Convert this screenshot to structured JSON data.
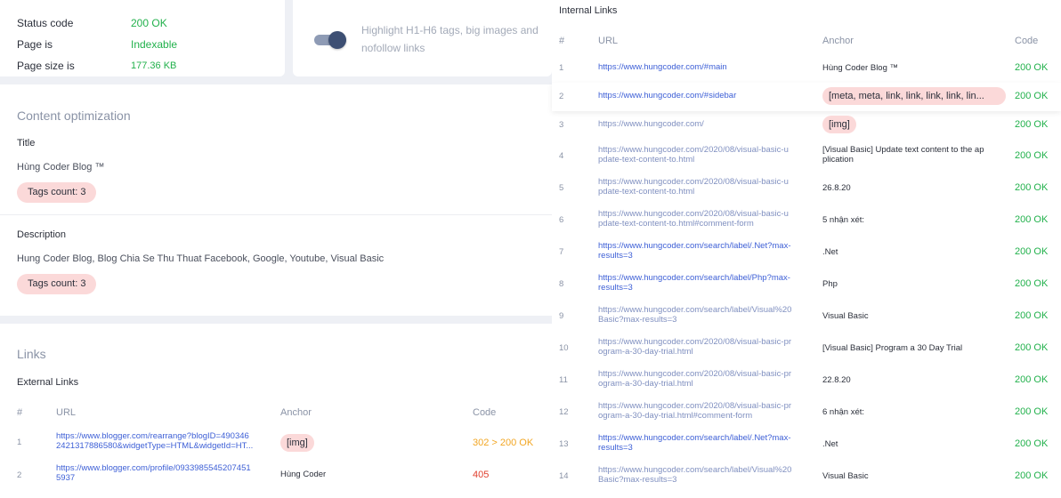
{
  "status": {
    "rows": [
      {
        "label": "Status code",
        "value": "200 OK"
      },
      {
        "label": "Page is",
        "value": "Indexable"
      },
      {
        "label": "Page size is",
        "value": "177.36 KB"
      }
    ]
  },
  "toggle": {
    "label": "Highlight H1-H6 tags, big images and nofollow links",
    "on": true
  },
  "content": {
    "title": "Content optimization",
    "title_section": {
      "heading": "Title",
      "value": "Hùng Coder Blog ™",
      "tags": "Tags count: 3"
    },
    "description_section": {
      "heading": "Description",
      "value": "Hung Coder Blog, Blog Chia Se Thu Thuat Facebook, Google, Youtube, Visual Basic",
      "tags": "Tags count: 3"
    }
  },
  "links": {
    "title": "Links",
    "external": {
      "heading": "External Links",
      "columns": [
        "#",
        "URL",
        "Anchor",
        "Code"
      ],
      "rows": [
        {
          "n": "1",
          "url1": "https://www.blogger.com/rearrange?blogID=490346",
          "url2": "2421317886580&widgetType=HTML&widgetId=HT...",
          "anchor": "[img]",
          "code": "302 > 200 OK"
        },
        {
          "n": "2",
          "url1": "https://www.blogger.com/profile/0933985545207451",
          "url2": "5937",
          "anchor": "Hùng Coder",
          "code": "405"
        }
      ]
    }
  },
  "internal": {
    "heading": "Internal Links",
    "columns": [
      "#",
      "URL",
      "Anchor",
      "Code"
    ],
    "rows": [
      {
        "n": "1",
        "url1": "https://www.hungcoder.com/#main",
        "url2": "",
        "anchor1": "Hùng Coder Blog ™",
        "anchor2": "",
        "code": "200 OK"
      },
      {
        "n": "2",
        "url1": "https://www.hungcoder.com/#sidebar",
        "url2": "",
        "anchor1": "[meta, meta, link, link, link, link, lin...",
        "anchor2": "",
        "code": "200 OK"
      },
      {
        "n": "3",
        "url1": "https://www.hungcoder.com/",
        "url2": "",
        "anchor1": "[img]",
        "anchor2": "",
        "code": "200 OK"
      },
      {
        "n": "4",
        "url1": "https://www.hungcoder.com/2020/08/visual-basic-u",
        "url2": "pdate-text-content-to.html",
        "anchor1": "[Visual Basic] Update text content to the ap",
        "anchor2": "plication",
        "code": "200 OK"
      },
      {
        "n": "5",
        "url1": "https://www.hungcoder.com/2020/08/visual-basic-u",
        "url2": "pdate-text-content-to.html",
        "anchor1": "26.8.20",
        "anchor2": "",
        "code": "200 OK"
      },
      {
        "n": "6",
        "url1": "https://www.hungcoder.com/2020/08/visual-basic-u",
        "url2": "pdate-text-content-to.html#comment-form",
        "anchor1": "5 nhận xét:",
        "anchor2": "",
        "code": "200 OK"
      },
      {
        "n": "7",
        "url1": "https://www.hungcoder.com/search/label/.Net?max-",
        "url2": "results=3",
        "anchor1": ".Net",
        "anchor2": "",
        "code": "200 OK"
      },
      {
        "n": "8",
        "url1": "https://www.hungcoder.com/search/label/Php?max-",
        "url2": "results=3",
        "anchor1": "Php",
        "anchor2": "",
        "code": "200 OK"
      },
      {
        "n": "9",
        "url1": "https://www.hungcoder.com/search/label/Visual%20",
        "url2": "Basic?max-results=3",
        "anchor1": "Visual Basic",
        "anchor2": "",
        "code": "200 OK"
      },
      {
        "n": "10",
        "url1": "https://www.hungcoder.com/2020/08/visual-basic-pr",
        "url2": "ogram-a-30-day-trial.html",
        "anchor1": "[Visual Basic] Program a 30 Day Trial",
        "anchor2": "",
        "code": "200 OK"
      },
      {
        "n": "11",
        "url1": "https://www.hungcoder.com/2020/08/visual-basic-pr",
        "url2": "ogram-a-30-day-trial.html",
        "anchor1": "22.8.20",
        "anchor2": "",
        "code": "200 OK"
      },
      {
        "n": "12",
        "url1": "https://www.hungcoder.com/2020/08/visual-basic-pr",
        "url2": "ogram-a-30-day-trial.html#comment-form",
        "anchor1": "6 nhận xét:",
        "anchor2": "",
        "code": "200 OK"
      },
      {
        "n": "13",
        "url1": "https://www.hungcoder.com/search/label/.Net?max-",
        "url2": "results=3",
        "anchor1": ".Net",
        "anchor2": "",
        "code": "200 OK"
      },
      {
        "n": "14",
        "url1": "https://www.hungcoder.com/search/label/Visual%20",
        "url2": "Basic?max-results=3",
        "anchor1": "Visual Basic",
        "anchor2": "",
        "code": "200 OK"
      }
    ]
  },
  "colors": {
    "ok": "#22b14c",
    "redirect": "#f2a623",
    "error": "#e0402f",
    "link": "#3d5fd6",
    "pill": "#fbd9d9"
  }
}
